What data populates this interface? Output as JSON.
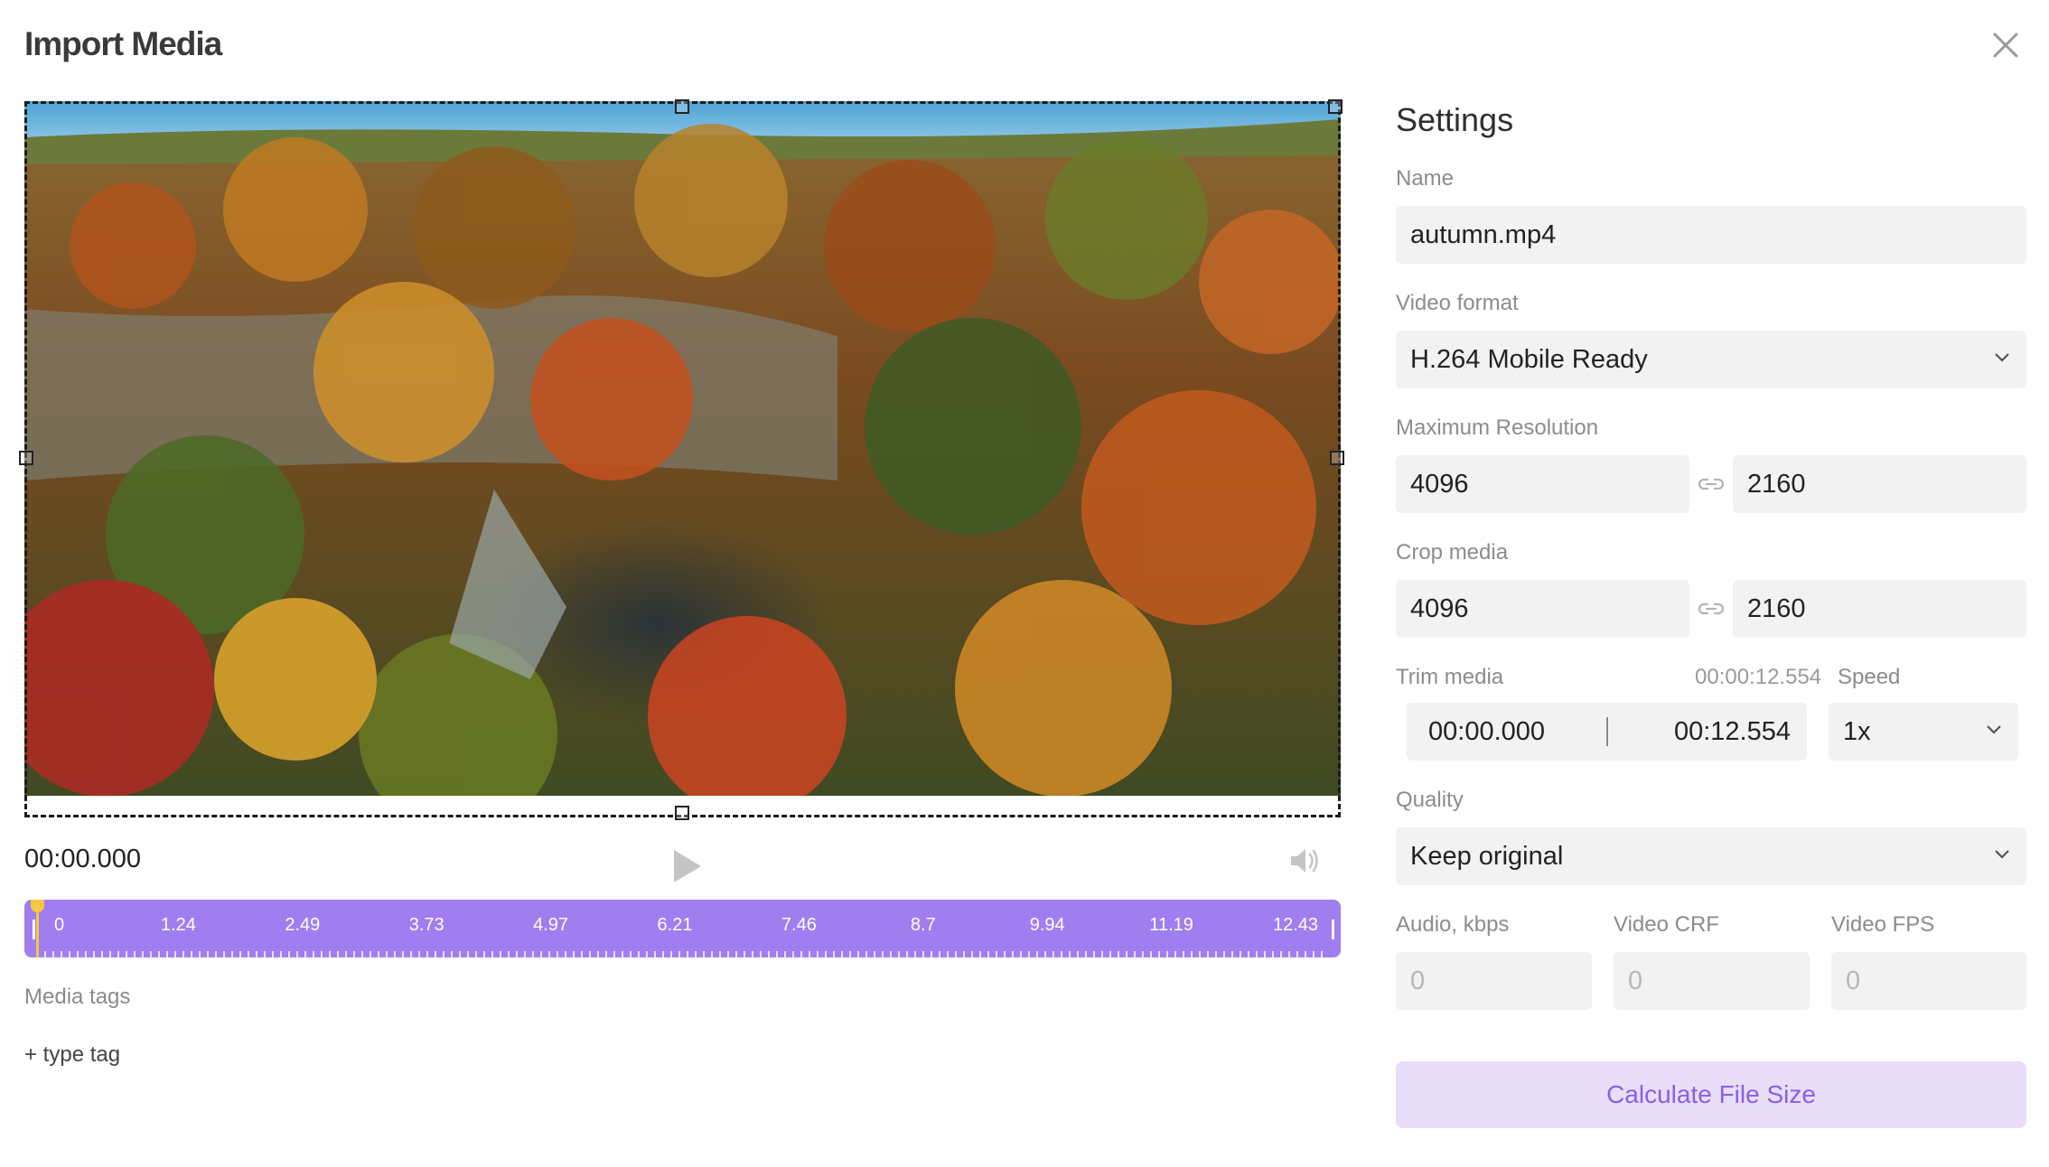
{
  "dialog": {
    "title": "Import Media",
    "close_icon": "close-icon"
  },
  "player": {
    "current_time": "00:00.000",
    "play_icon": "play-icon",
    "volume_icon": "volume-icon",
    "timeline": {
      "accent": "#a07ef0",
      "playhead_color": "#f6c843",
      "playhead_position": 0,
      "labels": [
        "0",
        "1.24",
        "2.49",
        "3.73",
        "4.97",
        "6.21",
        "7.46",
        "8.7",
        "9.94",
        "11.19",
        "12.43"
      ]
    }
  },
  "media_tags": {
    "label": "Media tags",
    "add_placeholder": "+ type tag"
  },
  "settings": {
    "title": "Settings",
    "name": {
      "label": "Name",
      "value": "autumn.mp4"
    },
    "video_format": {
      "label": "Video format",
      "value": "H.264 Mobile Ready"
    },
    "max_resolution": {
      "label": "Maximum Resolution",
      "width": "4096",
      "height": "2160"
    },
    "crop": {
      "label": "Crop media",
      "width": "4096",
      "height": "2160"
    },
    "trim": {
      "label": "Trim media",
      "duration": "00:00:12.554",
      "start": "00:00.000",
      "end": "00:12.554"
    },
    "speed": {
      "label": "Speed",
      "value": "1x"
    },
    "quality": {
      "label": "Quality",
      "value": "Keep original"
    },
    "audio_kbps": {
      "label": "Audio, kbps",
      "value": "0"
    },
    "video_crf": {
      "label": "Video CRF",
      "value": "0"
    },
    "video_fps": {
      "label": "Video FPS",
      "value": "0"
    },
    "calculate_button": "Calculate File Size",
    "button_color": "#e8defa",
    "button_text_color": "#8a5fe6"
  }
}
